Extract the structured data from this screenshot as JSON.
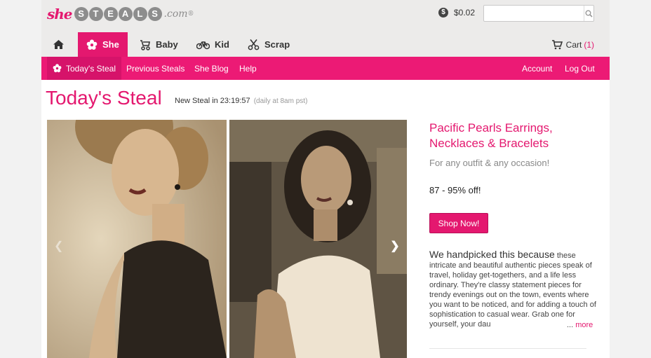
{
  "brand": {
    "she": "she",
    "steals_letters": [
      "S",
      "T",
      "E",
      "A",
      "L",
      "S"
    ],
    "com": ".com",
    "reg": "®",
    "pink": "#e4186f",
    "grey": "#8d8d8d"
  },
  "header": {
    "credit_icon": "dollar-coin-icon",
    "credit_symbol": "$",
    "credit_amount": "$0.02",
    "search_placeholder": "",
    "search_icon": "search-icon"
  },
  "categories": [
    {
      "label": "",
      "icon": "home-icon"
    },
    {
      "label": "She",
      "icon": "flower-icon"
    },
    {
      "label": "Baby",
      "icon": "stroller-icon"
    },
    {
      "label": "Kid",
      "icon": "bicycle-icon"
    },
    {
      "label": "Scrap",
      "icon": "scissors-icon"
    }
  ],
  "cart": {
    "label": "Cart",
    "count": "(1)",
    "icon": "cart-icon"
  },
  "subnav": {
    "todays_steal": "Today's Steal",
    "previous_steals": "Previous Steals",
    "she_blog": "She Blog",
    "help": "Help",
    "account": "Account",
    "log_out": "Log Out"
  },
  "page": {
    "title": "Today's Steal",
    "countdown_label": "New Steal in 23:19:57",
    "countdown_note": "(daily at 8am pst)"
  },
  "product": {
    "title": "Pacific Pearls Earrings, Necklaces & Bracelets",
    "subtitle": "For any outfit & any occasion!",
    "discount": "87 - 95% off!",
    "shop_button": "Shop Now!",
    "desc_lead": "We handpicked this because",
    "desc_body": "these intricate and beautiful authentic pieces speak of travel, holiday get-togethers, and a life less ordinary. They're classy statement pieces for trendy evenings out on the town, events where you want to be noticed, and for adding a touch of sophistication to casual wear. Grab one for yourself, your dau",
    "more_dots": "...",
    "more": "more"
  },
  "colors": {
    "accent": "#e4186f",
    "subnav": "#ec1a75",
    "header_bg": "#ecebea"
  }
}
